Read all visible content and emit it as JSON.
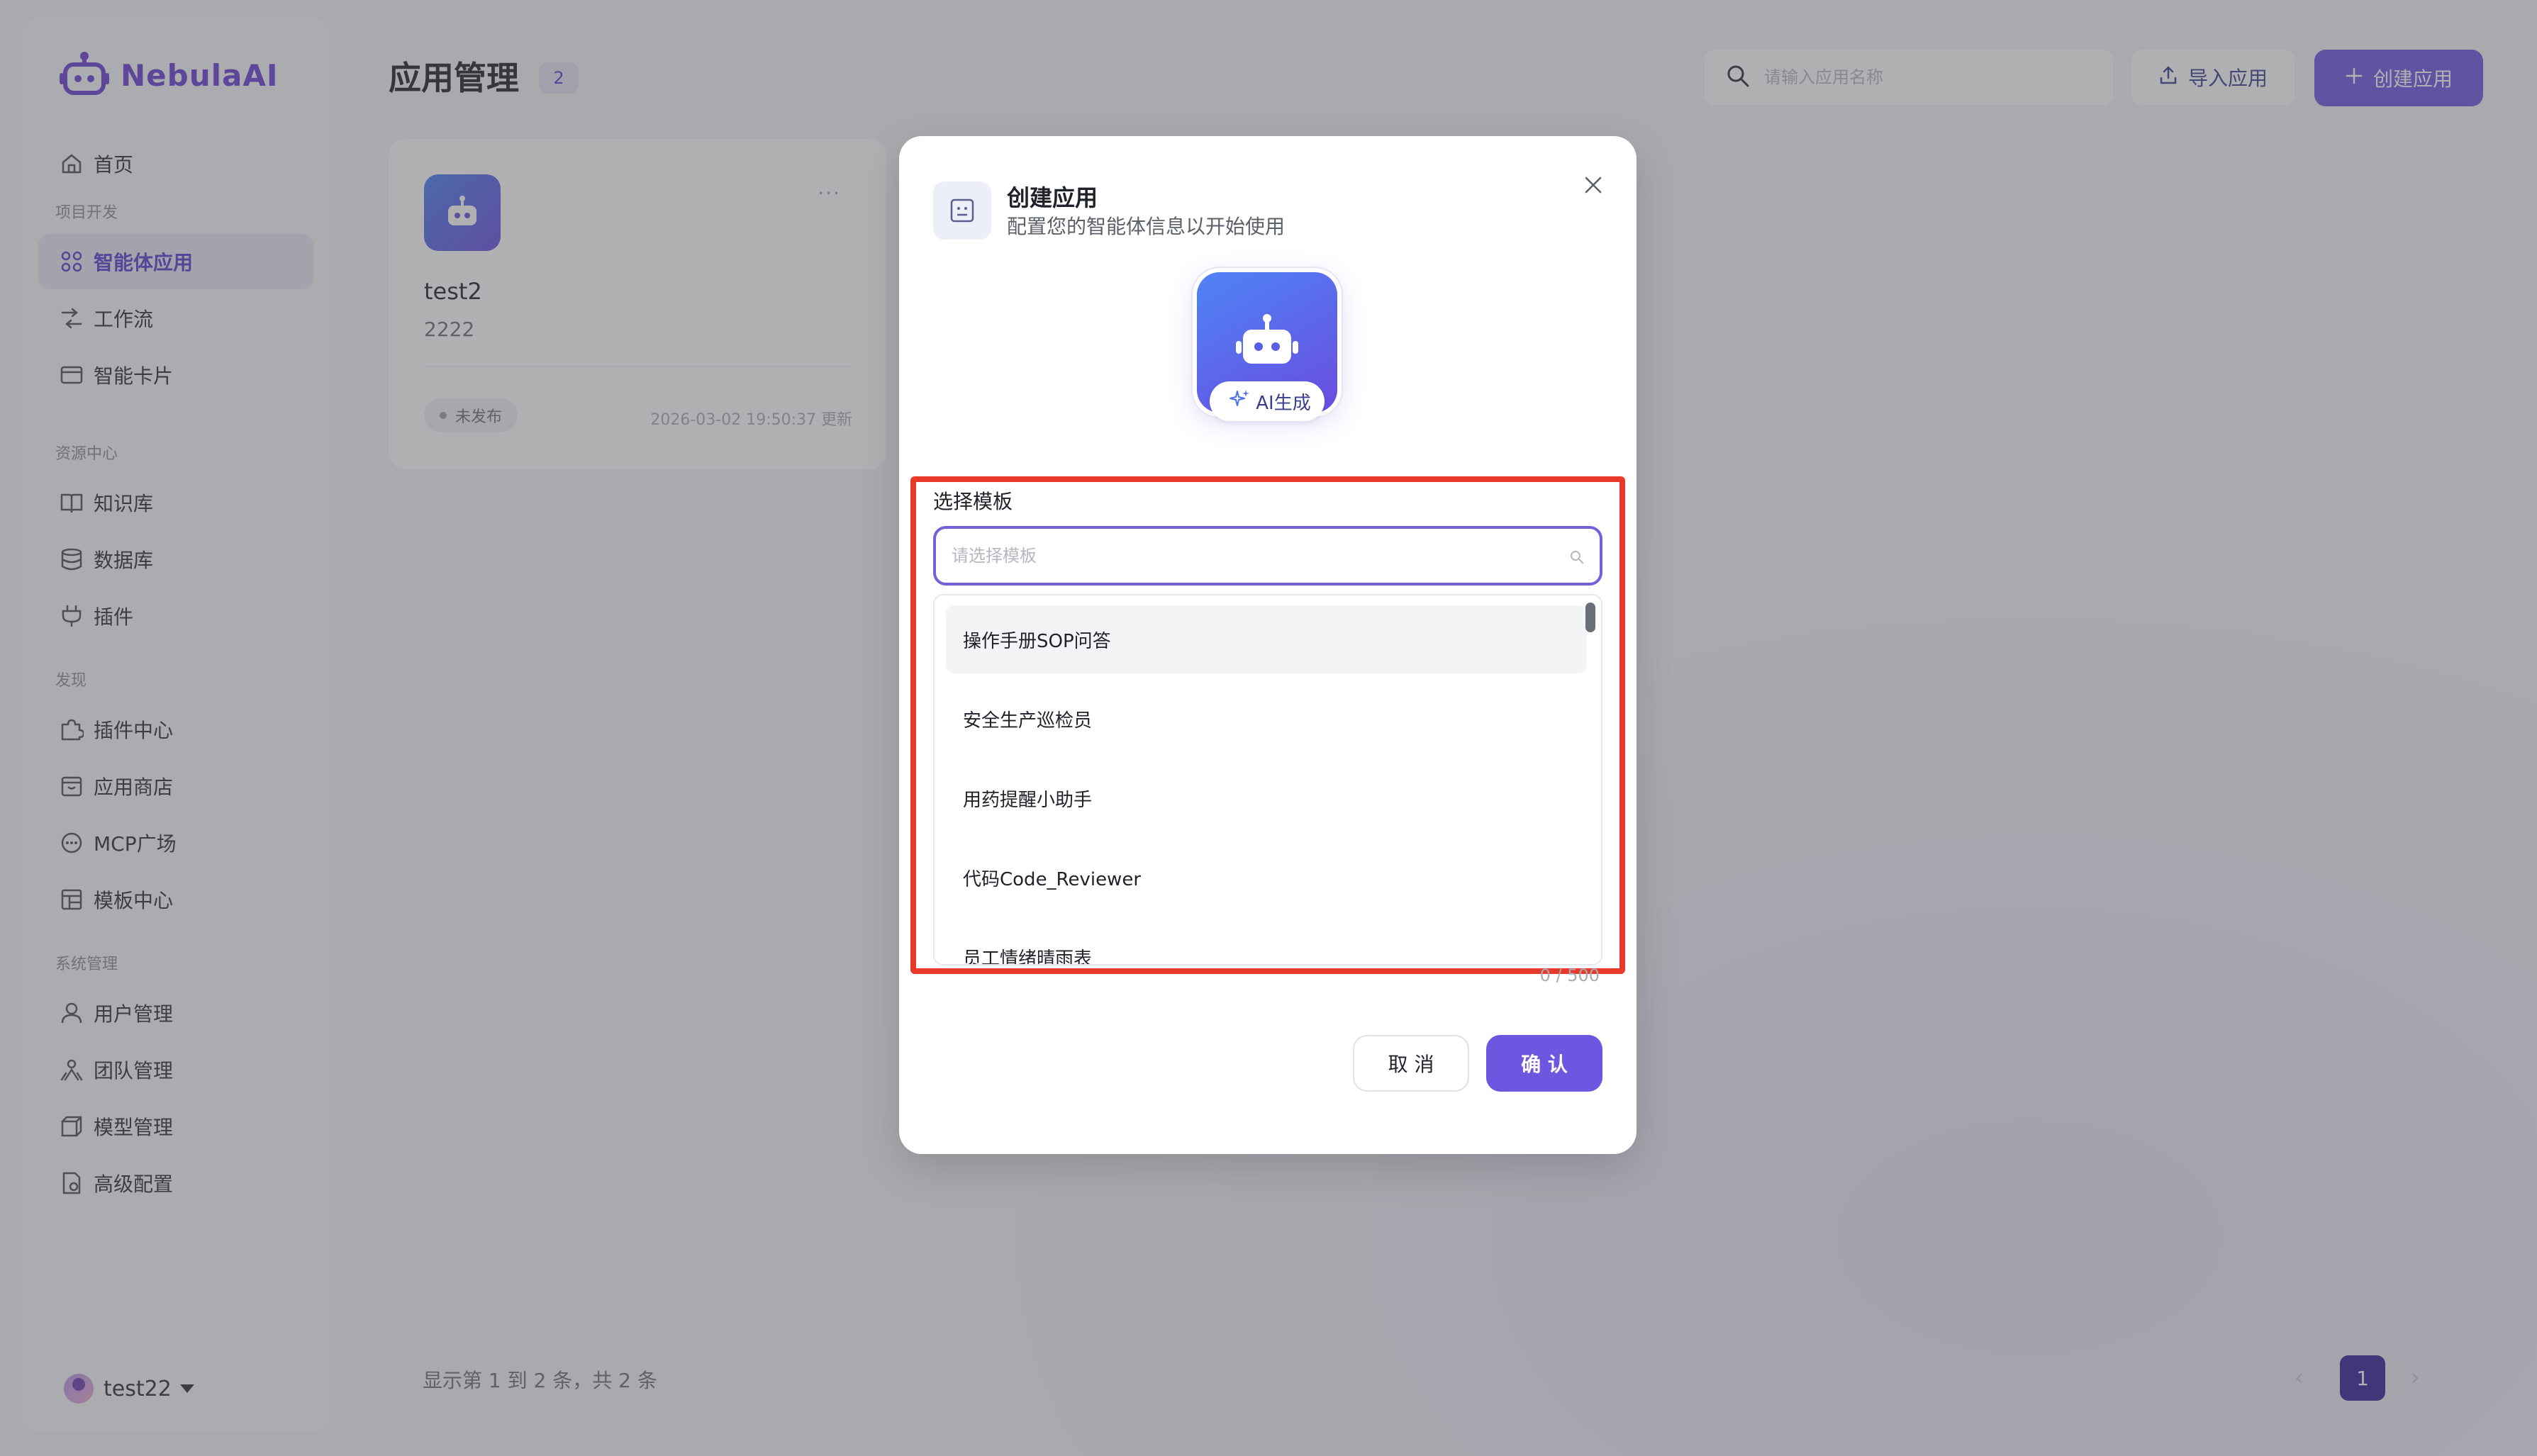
{
  "app": {
    "brand": "NebulaAI",
    "brand_color": "#6b3fd6",
    "accent_color": "#6f56e0"
  },
  "sidebar": {
    "home": {
      "label": "首页",
      "icon": "home-icon"
    },
    "sections": [
      {
        "title": "项目开发",
        "items": [
          {
            "label": "智能体应用",
            "icon": "grid-icon",
            "active": true
          },
          {
            "label": "工作流",
            "icon": "workflow-icon"
          },
          {
            "label": "智能卡片",
            "icon": "card-icon"
          }
        ]
      },
      {
        "title": "资源中心",
        "items": [
          {
            "label": "知识库",
            "icon": "book-icon"
          },
          {
            "label": "数据库",
            "icon": "database-icon"
          },
          {
            "label": "插件",
            "icon": "plug-icon"
          }
        ]
      },
      {
        "title": "发现",
        "items": [
          {
            "label": "插件中心",
            "icon": "puzzle-icon"
          },
          {
            "label": "应用商店",
            "icon": "store-icon"
          },
          {
            "label": "MCP广场",
            "icon": "mcp-icon"
          },
          {
            "label": "模板中心",
            "icon": "template-icon"
          }
        ]
      },
      {
        "title": "系统管理",
        "items": [
          {
            "label": "用户管理",
            "icon": "user-icon"
          },
          {
            "label": "团队管理",
            "icon": "team-icon"
          },
          {
            "label": "模型管理",
            "icon": "model-icon"
          },
          {
            "label": "高级配置",
            "icon": "config-icon"
          }
        ]
      }
    ],
    "user": {
      "name": "test22"
    }
  },
  "header": {
    "title": "应用管理",
    "count": "2",
    "search_placeholder": "请输入应用名称",
    "import_label": "导入应用",
    "create_label": "创建应用"
  },
  "card": {
    "name": "test2",
    "desc": "2222",
    "status": "未发布",
    "updated": "2026-03-02 19:50:37 更新"
  },
  "pagination": {
    "info": "显示第 1 到 2 条，共 2 条",
    "current": "1",
    "prev": "‹",
    "next": "›"
  },
  "modal": {
    "title": "创建应用",
    "subtitle": "配置您的智能体信息以开始使用",
    "ai_badge": "AI生成",
    "template_label": "选择模板",
    "template_placeholder": "请选择模板",
    "options": [
      "操作手册SOP问答",
      "安全生产巡检员",
      "用药提醒小助手",
      "代码Code_Reviewer",
      "员工情绪晴雨表"
    ],
    "char_count": "0 / 500",
    "cancel_label": "取 消",
    "ok_label": "确 认"
  }
}
